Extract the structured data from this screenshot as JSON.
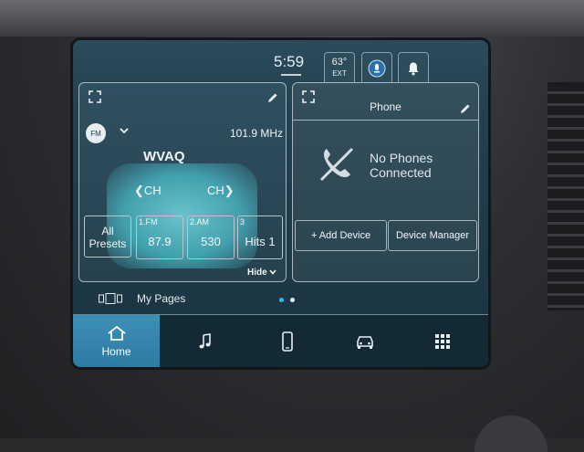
{
  "status": {
    "time": "5:59",
    "temperature": "63°",
    "temp_label": "EXT"
  },
  "radio": {
    "band": "FM",
    "frequency": "101.9 MHz",
    "station": "WVAQ",
    "ch_prev_label": "CH",
    "ch_next_label": "CH",
    "all_presets_line1": "All",
    "all_presets_line2": "Presets",
    "presets": [
      {
        "num": "1.FM",
        "value": "87.9"
      },
      {
        "num": "2.AM",
        "value": "530"
      },
      {
        "num": "3",
        "value": "Hits 1"
      }
    ],
    "hide_label": "Hide"
  },
  "phone": {
    "title": "Phone",
    "status_line1": "No Phones",
    "status_line2": "Connected",
    "add_device": "+ Add Device",
    "device_manager": "Device Manager"
  },
  "pages": {
    "label": "My Pages"
  },
  "nav": {
    "home_label": "Home"
  },
  "colors": {
    "accent": "#3d8fb6",
    "glow": "#6fd0d8",
    "page_dot_active": "#3fb3e4"
  }
}
